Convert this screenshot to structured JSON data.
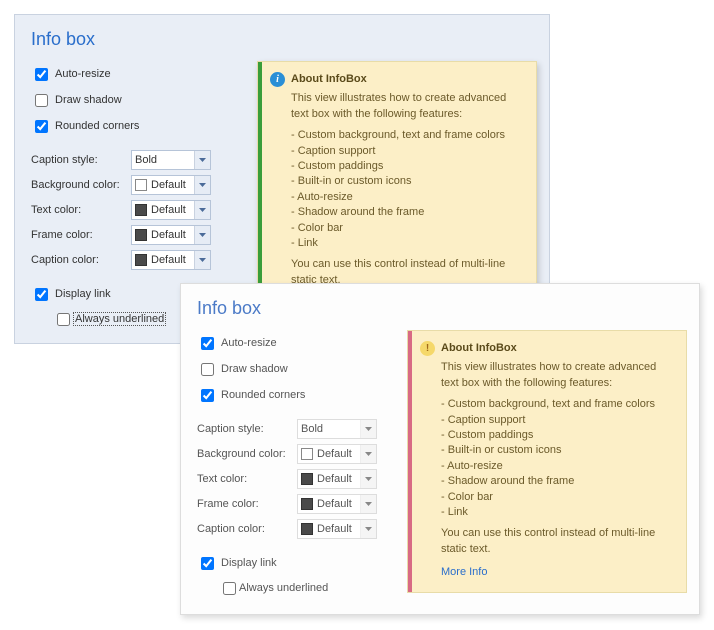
{
  "title": "Info box",
  "checkboxes": {
    "auto_resize": {
      "label": "Auto-resize",
      "checked": true
    },
    "draw_shadow": {
      "label": "Draw shadow",
      "checked": false
    },
    "rounded_corners": {
      "label": "Rounded corners",
      "checked": true
    },
    "display_link": {
      "label": "Display link",
      "checked": true
    },
    "always_underlined": {
      "label": "Always underlined",
      "checked": false
    }
  },
  "fields": {
    "caption_style": {
      "label": "Caption style:",
      "value": "Bold"
    },
    "background_color": {
      "label": "Background color:",
      "value": "Default",
      "swatch": "white"
    },
    "text_color": {
      "label": "Text color:",
      "value": "Default",
      "swatch": "dark"
    },
    "frame_color": {
      "label": "Frame color:",
      "value": "Default",
      "swatch": "dark"
    },
    "caption_color": {
      "label": "Caption color:",
      "value": "Default",
      "swatch": "dark"
    }
  },
  "infobox": {
    "title": "About InfoBox",
    "intro": "This view illustrates how to create advanced text box with the following features:",
    "features": [
      "Custom background, text and frame colors",
      "Caption support",
      "Custom paddings",
      "Built-in or custom icons",
      "Auto-resize",
      "Shadow around the frame",
      "Color bar",
      "Link"
    ],
    "footer": "You can use this control instead of multi-line static text.",
    "link": "More Info"
  }
}
